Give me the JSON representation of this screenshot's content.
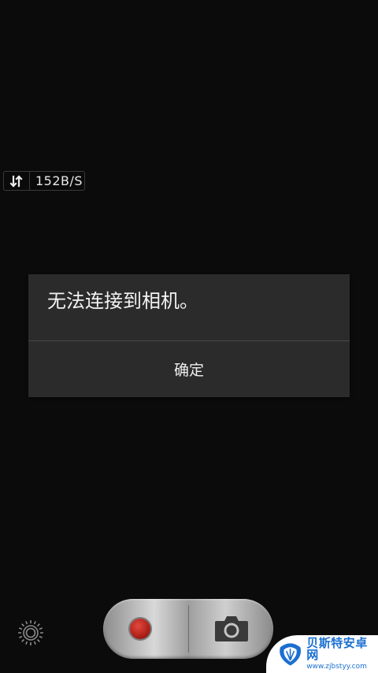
{
  "status": {
    "network_speed": "152B/S",
    "speed_icon": "up-down-arrows-icon"
  },
  "dialog": {
    "message": "无法连接到相机。",
    "confirm_label": "确定"
  },
  "controls": {
    "settings_icon": "gear-icon",
    "record_icon": "record-icon",
    "shutter_icon": "camera-icon",
    "record_color": "#c0281f"
  },
  "watermark": {
    "title": "贝斯特安卓网",
    "url": "www.zjbstyy.com"
  }
}
